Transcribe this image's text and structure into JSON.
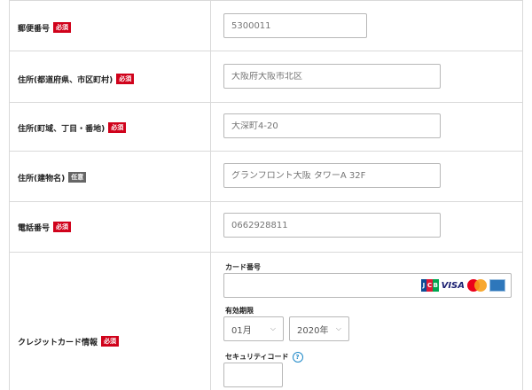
{
  "badges": {
    "required": "必須",
    "optional": "任意"
  },
  "rows": [
    {
      "label": "郵便番号",
      "badge": "必須",
      "placeholder": "5300011"
    },
    {
      "label": "住所(都道府県、市区町村)",
      "badge": "必須",
      "placeholder": "大阪府大阪市北区"
    },
    {
      "label": "住所(町域、丁目・番地)",
      "badge": "必須",
      "placeholder": "大深町4-20"
    },
    {
      "label": "住所(建物名)",
      "badge": "任意",
      "placeholder": "グランフロント大阪 タワーA 32F"
    },
    {
      "label": "電話番号",
      "badge": "必須",
      "placeholder": "0662928811"
    }
  ],
  "credit_card": {
    "label": "クレジットカード情報",
    "badge": "必須",
    "card_number_label": "カード番号",
    "card_number_value": "",
    "brands": [
      "jcb-icon",
      "visa-icon",
      "mastercard-icon",
      "amex-icon"
    ],
    "visa_text": "VISA",
    "expiry_label": "有効期限",
    "month_value": "01月",
    "year_value": "2020年",
    "security_code_label": "セキュリティコード",
    "help_symbol": "?",
    "security_code_value": ""
  },
  "colors": {
    "required_badge": "#d0021b",
    "optional_badge": "#666666",
    "border": "#d9d9d9",
    "help": "#1e88c8"
  }
}
